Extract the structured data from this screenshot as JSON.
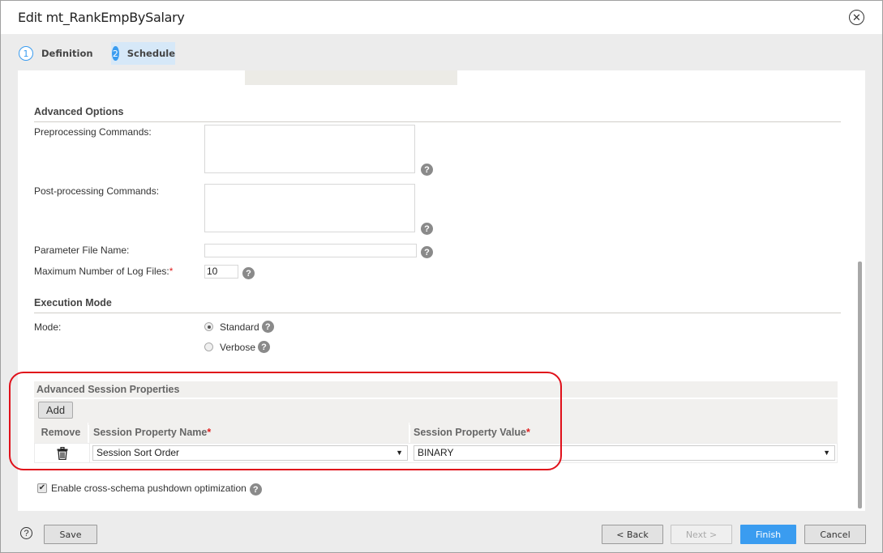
{
  "dialog": {
    "title": "Edit mt_RankEmpBySalary",
    "close_icon": "close-circle-icon"
  },
  "steps": [
    {
      "number": "1",
      "label": "Definition",
      "active": false
    },
    {
      "number": "2",
      "label": "Schedule",
      "active": true
    }
  ],
  "advanced_options": {
    "title": "Advanced Options",
    "preprocessing_label": "Preprocessing Commands:",
    "preprocessing_value": "",
    "postprocessing_label": "Post-processing Commands:",
    "postprocessing_value": "",
    "param_file_label": "Parameter File Name:",
    "param_file_value": "",
    "max_log_label": "Maximum Number of Log Files:",
    "max_log_required": "*",
    "max_log_value": "10"
  },
  "execution_mode": {
    "title": "Execution Mode",
    "mode_label": "Mode:",
    "options": [
      {
        "label": "Standard",
        "selected": true
      },
      {
        "label": "Verbose",
        "selected": false
      }
    ]
  },
  "advanced_session_properties": {
    "title": "Advanced Session Properties",
    "add_label": "Add",
    "columns": {
      "remove": "Remove",
      "name": "Session Property Name",
      "value": "Session Property Value",
      "required": "*"
    },
    "rows": [
      {
        "name": "Session Sort Order",
        "value": "BINARY"
      }
    ],
    "dropdown_arrow": "▼"
  },
  "cross_schema": {
    "label": "Enable cross-schema pushdown optimization",
    "checked": true,
    "check_glyph": "✔"
  },
  "help_glyph": "?",
  "close_glyph": "✕",
  "footer": {
    "help_glyph": "?",
    "save_label": "Save",
    "back_label": "< Back",
    "next_label": "Next >",
    "finish_label": "Finish",
    "cancel_label": "Cancel"
  },
  "colors": {
    "accent": "#3a9cf0",
    "required": "#e02020",
    "highlight": "#e0101a"
  }
}
